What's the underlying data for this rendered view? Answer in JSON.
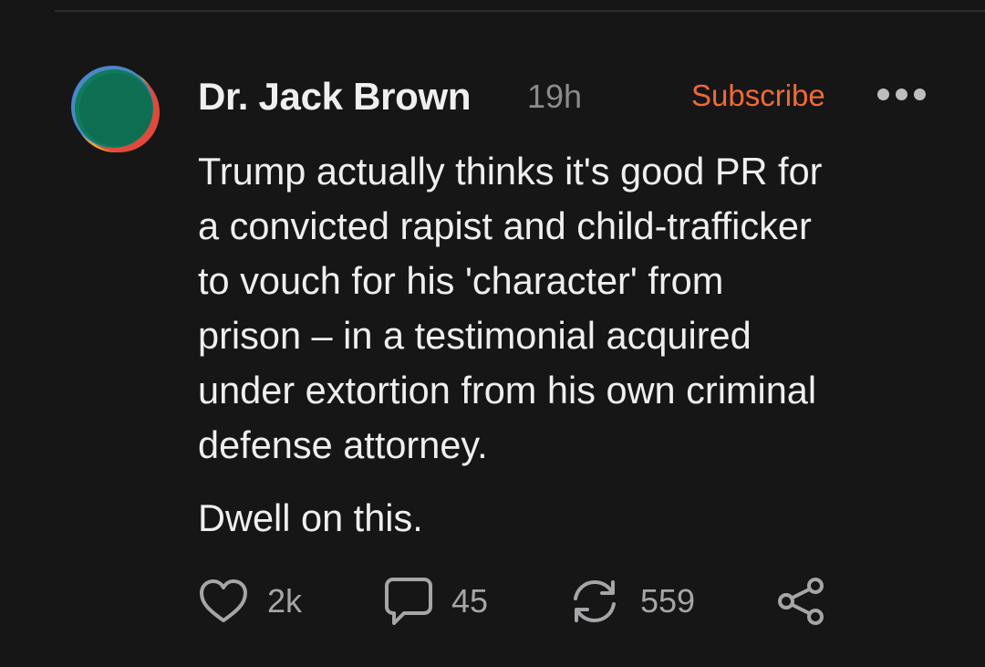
{
  "post": {
    "author": "Dr. Jack Brown",
    "timestamp": "19h",
    "subscribe_label": "Subscribe",
    "more_icon": "more-horizontal-icon",
    "paragraphs": [
      "Trump actually thinks it's good PR for\na convicted rapist and child-trafficker\nto vouch for his 'character' from\nprison – in a testimonial acquired\nunder extortion from his own criminal\ndefense attorney.",
      "Dwell on this."
    ]
  },
  "actions": {
    "likes": "2k",
    "comments": "45",
    "restacks": "559",
    "icons": {
      "like": "heart-icon",
      "comment": "comment-bubble-icon",
      "restack": "restack-icon",
      "share": "share-icon"
    }
  },
  "colors": {
    "background": "#161617",
    "text": "#efefef",
    "muted": "#8b8b8e",
    "accent": "#f26a32"
  }
}
